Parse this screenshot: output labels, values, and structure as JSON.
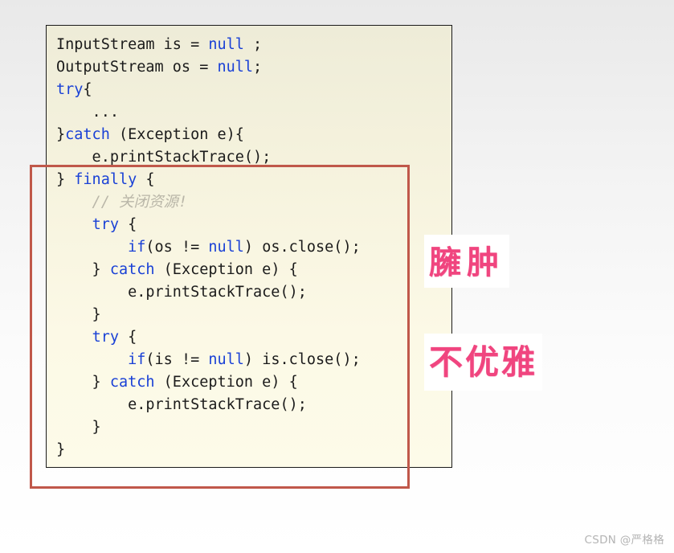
{
  "page": {
    "background_top_color": "#e9e9e9",
    "background_bottom_color": "#ffffff"
  },
  "code_block": {
    "border_color": "#1a1a1a",
    "background_color": "#fbf8e4",
    "keyword_color": "#1a41d6",
    "comment_color": "#b9b6a8",
    "text_color": "#1b1b1b",
    "language": "java",
    "lines": [
      [
        {
          "t": "InputStream is = ",
          "c": "plain"
        },
        {
          "t": "null",
          "c": "kw"
        },
        {
          "t": " ;",
          "c": "plain"
        }
      ],
      [
        {
          "t": "OutputStream os = ",
          "c": "plain"
        },
        {
          "t": "null",
          "c": "kw"
        },
        {
          "t": ";",
          "c": "plain"
        }
      ],
      [
        {
          "t": "try",
          "c": "kw"
        },
        {
          "t": "{",
          "c": "plain"
        }
      ],
      [
        {
          "t": "    ...",
          "c": "plain"
        }
      ],
      [
        {
          "t": "}",
          "c": "plain"
        },
        {
          "t": "catch",
          "c": "kw"
        },
        {
          "t": " (Exception e){",
          "c": "plain"
        }
      ],
      [
        {
          "t": "    e.printStackTrace();",
          "c": "plain"
        }
      ],
      [
        {
          "t": "} ",
          "c": "plain"
        },
        {
          "t": "finally",
          "c": "kw"
        },
        {
          "t": " {",
          "c": "plain"
        }
      ],
      [
        {
          "t": "    // 关闭资源!",
          "c": "cmt"
        }
      ],
      [
        {
          "t": "    ",
          "c": "plain"
        },
        {
          "t": "try",
          "c": "kw"
        },
        {
          "t": " {",
          "c": "plain"
        }
      ],
      [
        {
          "t": "        ",
          "c": "plain"
        },
        {
          "t": "if",
          "c": "kw"
        },
        {
          "t": "(os != ",
          "c": "plain"
        },
        {
          "t": "null",
          "c": "kw"
        },
        {
          "t": ") os.close();",
          "c": "plain"
        }
      ],
      [
        {
          "t": "    } ",
          "c": "plain"
        },
        {
          "t": "catch",
          "c": "kw"
        },
        {
          "t": " (Exception e) {",
          "c": "plain"
        }
      ],
      [
        {
          "t": "        e.printStackTrace();",
          "c": "plain"
        }
      ],
      [
        {
          "t": "    }",
          "c": "plain"
        }
      ],
      [
        {
          "t": "    ",
          "c": "plain"
        },
        {
          "t": "try",
          "c": "kw"
        },
        {
          "t": " {",
          "c": "plain"
        }
      ],
      [
        {
          "t": "        ",
          "c": "plain"
        },
        {
          "t": "if",
          "c": "kw"
        },
        {
          "t": "(is != ",
          "c": "plain"
        },
        {
          "t": "null",
          "c": "kw"
        },
        {
          "t": ") is.close();",
          "c": "plain"
        }
      ],
      [
        {
          "t": "    } ",
          "c": "plain"
        },
        {
          "t": "catch",
          "c": "kw"
        },
        {
          "t": " (Exception e) {",
          "c": "plain"
        }
      ],
      [
        {
          "t": "        e.printStackTrace();",
          "c": "plain"
        }
      ],
      [
        {
          "t": "    }",
          "c": "plain"
        }
      ],
      [
        {
          "t": "}",
          "c": "plain"
        }
      ]
    ]
  },
  "annotations": {
    "highlight_rect": {
      "label": "finally-block-highlight",
      "stroke_color": "#c0584a",
      "stroke_width": 3
    },
    "notes": [
      {
        "text": "臃肿",
        "color": "#f0457f",
        "meaning": "bloated"
      },
      {
        "text": "不优雅",
        "color": "#f0457f",
        "meaning": "not elegant"
      }
    ]
  },
  "watermark": {
    "text": "CSDN @严格格",
    "color": "#b4b4b4"
  }
}
